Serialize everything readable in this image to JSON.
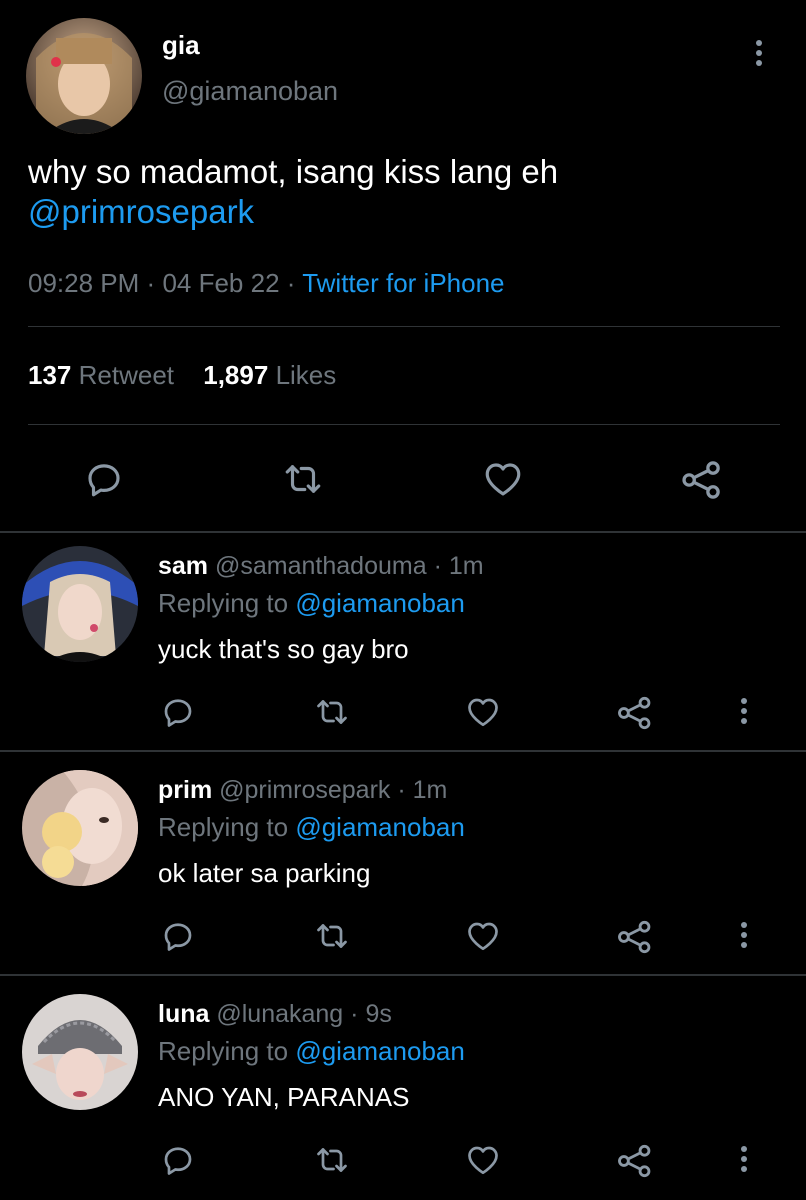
{
  "main_tweet": {
    "name": "gia",
    "handle": "@giamanoban",
    "text_line1": "why so madamot, isang kiss lang eh",
    "mention": "@primrosepark",
    "time": "09:28 PM",
    "sep1": "·",
    "date": "04 Feb 22",
    "sep2": "·",
    "source": "Twitter for iPhone",
    "retweet_count": "137",
    "retweet_label": "Retweet",
    "like_count": "1,897",
    "like_label": "Likes"
  },
  "replies": [
    {
      "name": "sam",
      "handle": "@samanthadouma",
      "time": "· 1m",
      "replying_label": "Replying to",
      "replying_to": "@giamanoban",
      "text": "yuck that's so gay bro"
    },
    {
      "name": "prim",
      "handle": "@primrosepark",
      "time": "· 1m",
      "replying_label": "Replying to",
      "replying_to": "@giamanoban",
      "text": "ok later sa parking"
    },
    {
      "name": "luna",
      "handle": "@lunakang",
      "time": "· 9s",
      "replying_label": "Replying to",
      "replying_to": "@giamanoban",
      "text": "ANO YAN, PARANAS"
    }
  ],
  "icons": [
    "reply-icon",
    "retweet-icon",
    "like-icon",
    "share-icon",
    "more-icon"
  ],
  "colors": {
    "background": "#000000",
    "text": "#e7e9ea",
    "muted": "#6e767d",
    "link": "#1d9bf0",
    "divider": "#2f3336"
  }
}
